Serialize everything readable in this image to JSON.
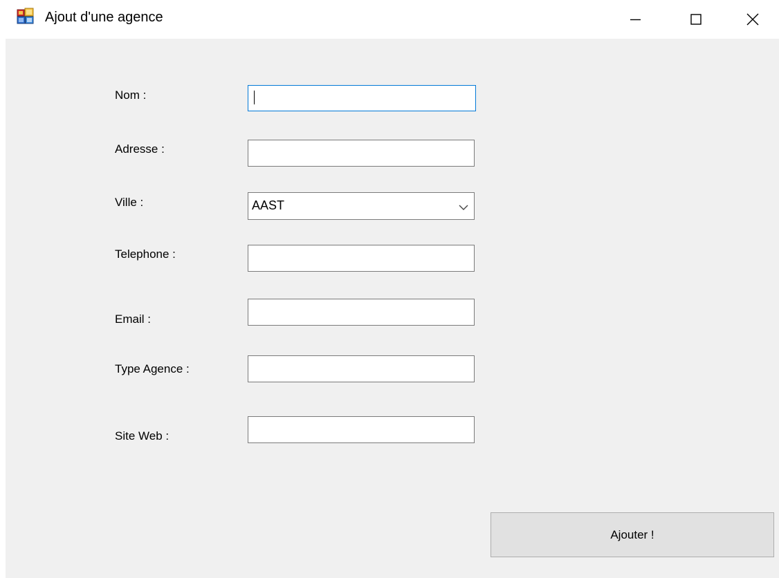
{
  "window": {
    "title": "Ajout d'une agence",
    "app_icon": "winforms-app-icon",
    "controls": {
      "minimize_icon": "minimize-icon",
      "maximize_icon": "maximize-icon",
      "close_icon": "close-icon"
    }
  },
  "form": {
    "nom": {
      "label": "Nom :",
      "value": ""
    },
    "adresse": {
      "label": "Adresse :",
      "value": ""
    },
    "ville": {
      "label": "Ville :",
      "selected": "AAST"
    },
    "telephone": {
      "label": "Telephone :",
      "value": ""
    },
    "email": {
      "label": "Email :",
      "value": ""
    },
    "type_agence": {
      "label": "Type Agence :",
      "value": ""
    },
    "site_web": {
      "label": "Site Web :",
      "value": ""
    },
    "submit_label": "Ajouter !"
  },
  "colors": {
    "client_background": "#f0f0f0",
    "focus_border": "#0078d7",
    "button_face": "#e1e1e1"
  }
}
